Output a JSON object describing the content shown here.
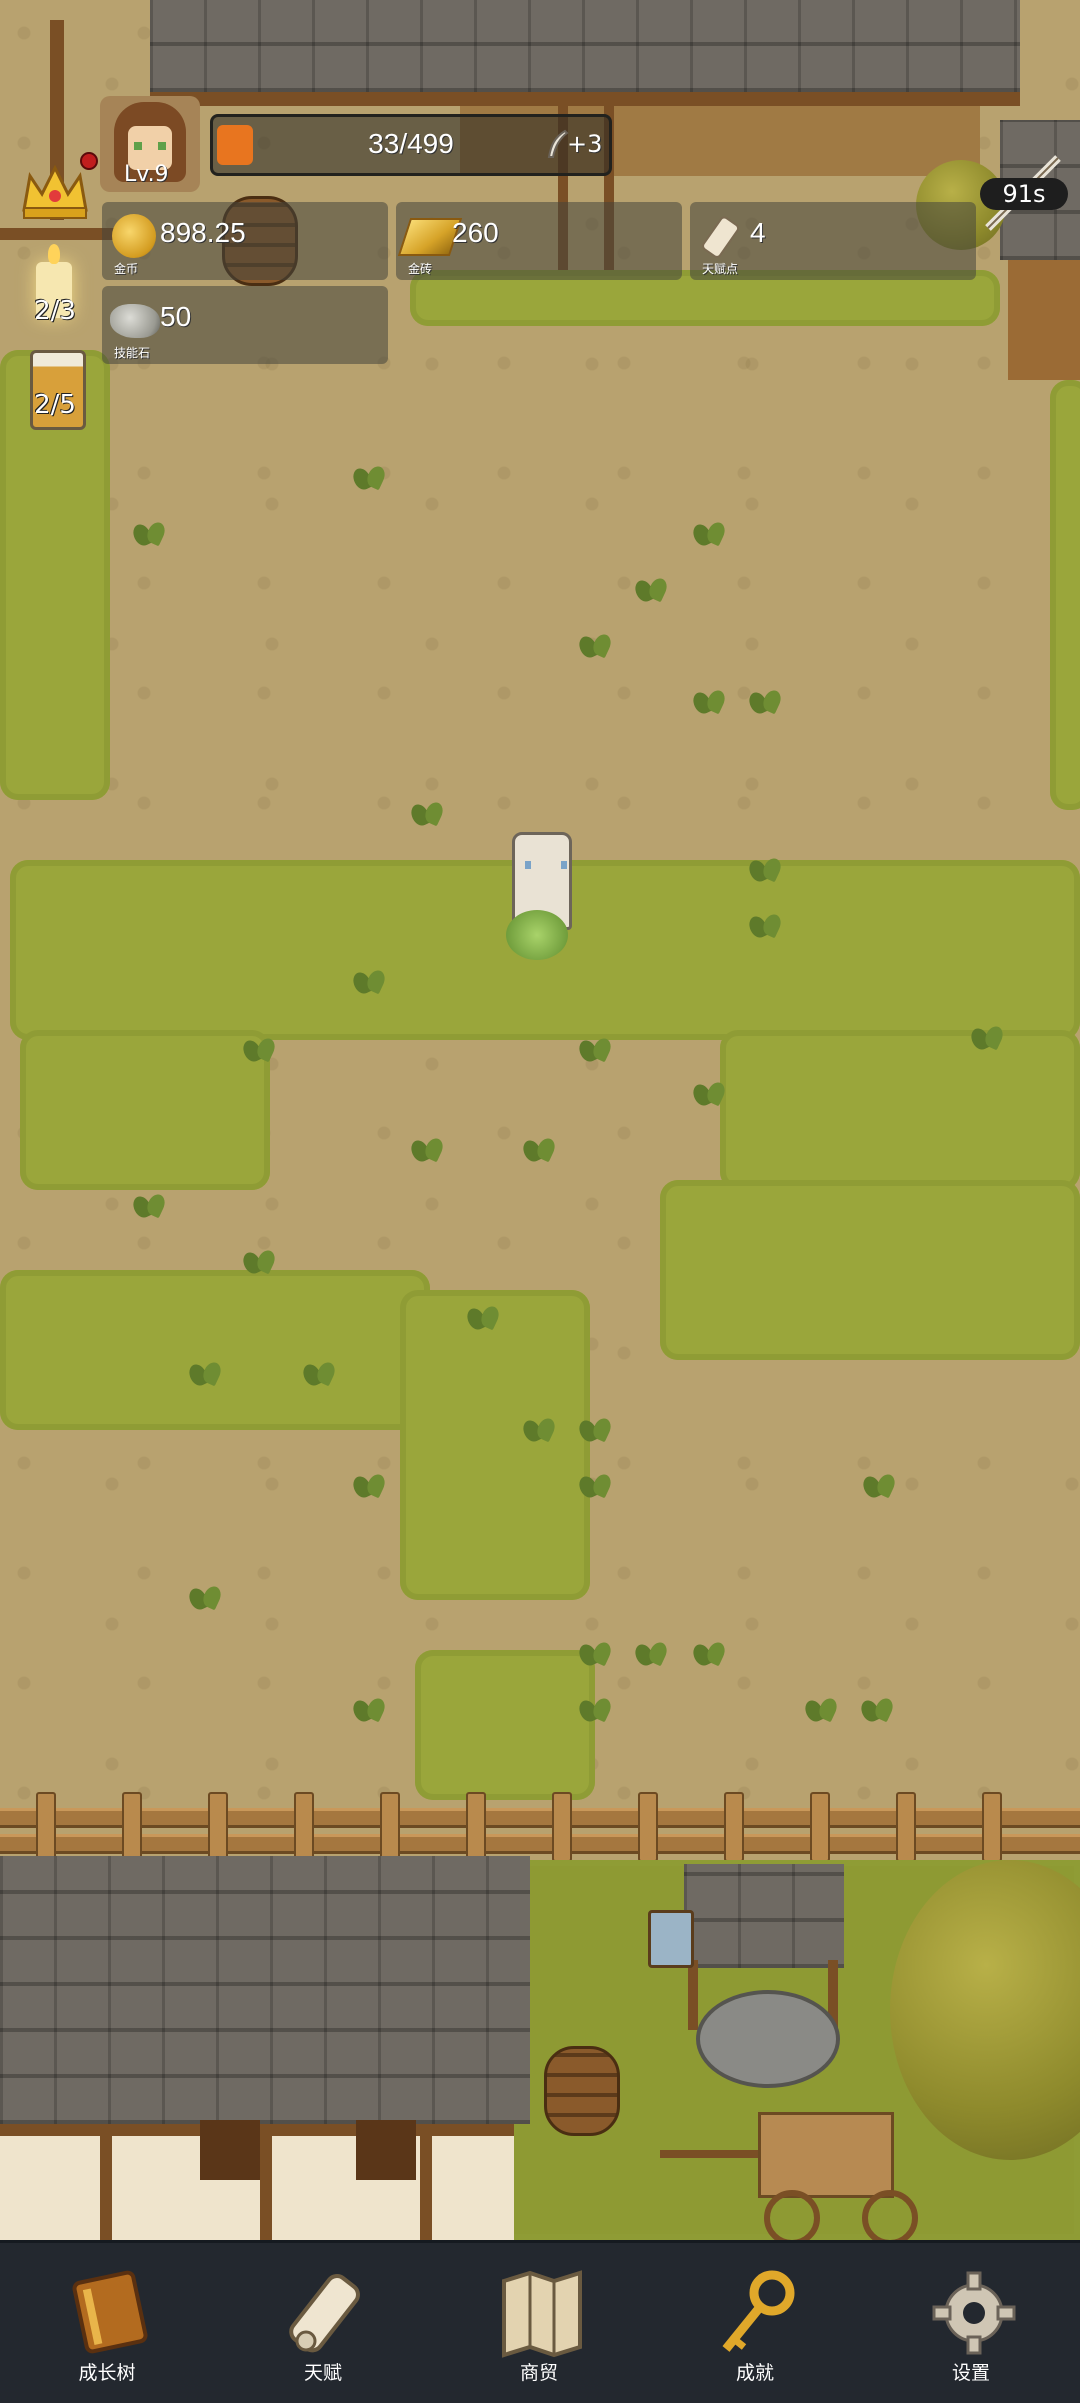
{
  "player": {
    "level": "Lv.9"
  },
  "xp": {
    "current": 33,
    "max": 499,
    "text": "33/499",
    "gain": "+3"
  },
  "resources": {
    "gold": {
      "value": "898.25",
      "caption": "金币"
    },
    "gold_brick": {
      "value": "260",
      "caption": "金砖"
    },
    "talent_points": {
      "value": "4",
      "caption": "天赋点"
    },
    "skill_stone": {
      "value": "50",
      "caption": "技能石"
    }
  },
  "side_counters": {
    "candle": "2/3",
    "beer": "2/5"
  },
  "timer": {
    "value": "91s"
  },
  "nav": {
    "items": [
      {
        "label": "成长树",
        "icon": "book-icon"
      },
      {
        "label": "天赋",
        "icon": "scroll-icon"
      },
      {
        "label": "商贸",
        "icon": "map-icon"
      },
      {
        "label": "成就",
        "icon": "key-icon"
      },
      {
        "label": "设置",
        "icon": "gear-icon"
      }
    ]
  },
  "colors": {
    "nav_bg": "#23282f",
    "xp_fill": "#e8751f",
    "grass": "#9aa63b",
    "dirt": "#b8a26f"
  }
}
